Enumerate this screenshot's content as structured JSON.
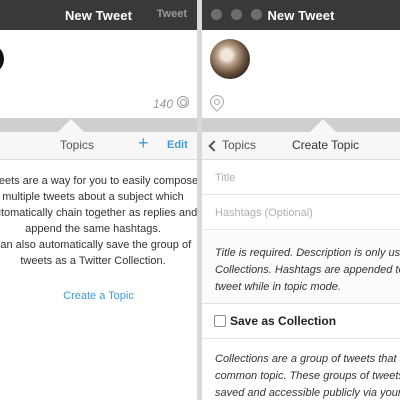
{
  "left_panel": {
    "window_title": "New Tweet",
    "tweet_button": "Tweet",
    "char_count": "140",
    "topics_header": "Topics",
    "add_symbol": "+",
    "edit_button": "Edit",
    "description_lines": [
      "tweets are a way for you to easily compose",
      "multiple tweets about a subject which",
      "automatically chain together as replies and",
      "append the same hashtags."
    ],
    "collection_lines": [
      "can also automatically save the group of",
      "tweets as a Twitter Collection."
    ],
    "create_topic_link": "Create a Topic"
  },
  "right_panel": {
    "window_title": "New Tweet",
    "back_label": "Topics",
    "header_title": "Create Topic",
    "title_placeholder": "Title",
    "hashtags_placeholder": "Hashtags (Optional)",
    "required_note_lines": [
      "Title is required. Description is only used",
      "Collections. Hashtags are appended to e",
      "tweet while in topic mode."
    ],
    "save_as_collection": "Save as Collection",
    "save_as_collection_checked": false,
    "collections_note_lines": [
      "Collections are a group of tweets that sh",
      "common topic. These groups of tweets w",
      "saved and accessible publicly via your pr"
    ]
  },
  "colors": {
    "titlebar": "#393939",
    "accent": "#3e9bd8",
    "band": "#cfcfcf"
  }
}
